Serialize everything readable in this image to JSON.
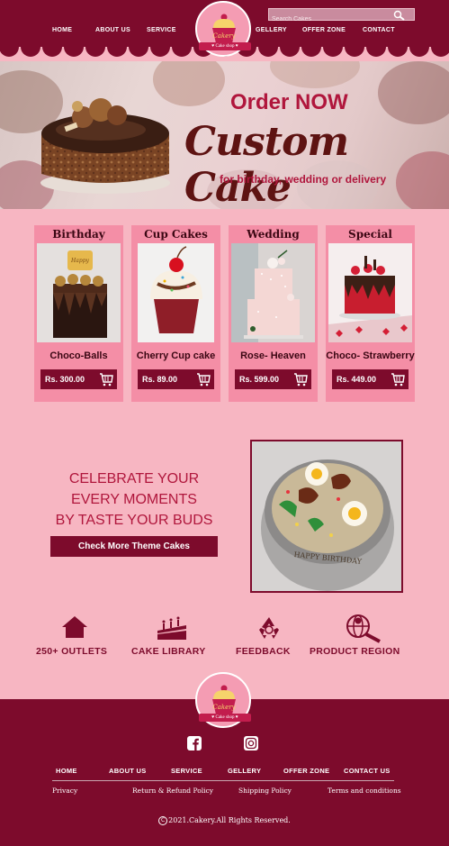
{
  "header": {
    "nav_left": [
      "HOME",
      "ABOUT US",
      "SERVICE"
    ],
    "nav_right": [
      "GELLERY",
      "OFFER ZONE",
      "CONTACT"
    ],
    "search_placeholder": "Search Cakes",
    "logo_text": "Cakery",
    "logo_ribbon": "Cake shop"
  },
  "hero": {
    "order": "Order NOW",
    "title": "Custom Cake",
    "subtitle": "for birthday, wedding or delivery"
  },
  "cards": [
    {
      "title": "Birthday",
      "name": "Choco-Balls",
      "price": "Rs. 300.00"
    },
    {
      "title": "Cup Cakes",
      "name": "Cherry Cup cake",
      "price": "Rs. 89.00"
    },
    {
      "title": "Wedding",
      "name": "Rose- Heaven",
      "price": "Rs. 599.00"
    },
    {
      "title": "Special",
      "name": "Choco- Strawberry",
      "price": "Rs. 449.00"
    }
  ],
  "celebrate": {
    "lines": [
      "CELEBRATE YOUR",
      "EVERY MOMENTS",
      "BY TASTE YOUR BUDS"
    ],
    "button": "Check More Theme Cakes",
    "cake_text": "HAPPY BIRTHDAY"
  },
  "features": [
    "250+ OUTLETS",
    "CAKE LIBRARY",
    "FEEDBACK",
    "PRODUCT REGION"
  ],
  "footer": {
    "nav": [
      "HOME",
      "ABOUT US",
      "SERVICE",
      "GELLERY",
      "OFFER ZONE",
      "CONTACT US"
    ],
    "links": [
      "Privacy",
      "Return & Refund Policy",
      "Shipping Policy",
      "Terms and conditions"
    ],
    "copyright": "2021.Cakery.All Rights Reserved."
  },
  "colors": {
    "maroon": "#7d0b2c",
    "pink_bg": "#f7b6c2",
    "card_pink": "#f48ea6",
    "accent_red": "#b0163c"
  },
  "icons": [
    "search-icon",
    "cart-icon",
    "home-icon",
    "cake-icon",
    "recycle-icon",
    "globe-search-icon",
    "facebook-icon",
    "instagram-icon",
    "copyright-icon"
  ]
}
